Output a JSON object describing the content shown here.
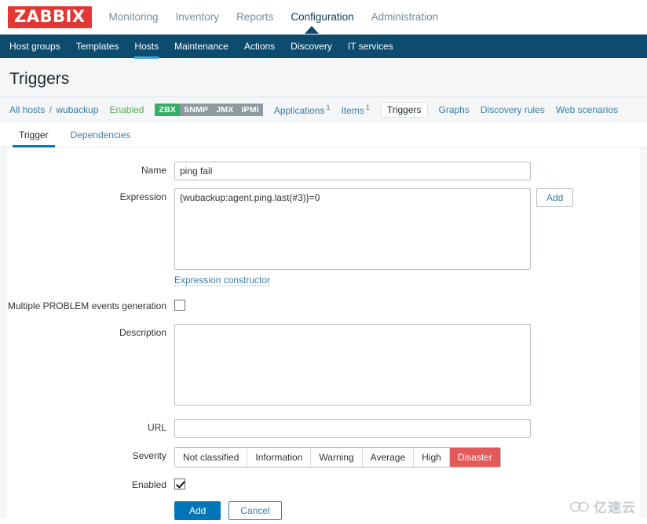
{
  "brand": {
    "logo_text": "ZABBIX",
    "logo_color": "#e33734"
  },
  "mainnav": {
    "items": [
      {
        "label": "Monitoring",
        "active": false
      },
      {
        "label": "Inventory",
        "active": false
      },
      {
        "label": "Reports",
        "active": false
      },
      {
        "label": "Configuration",
        "active": true
      },
      {
        "label": "Administration",
        "active": false
      }
    ]
  },
  "subnav": {
    "items": [
      {
        "label": "Host groups",
        "active": false
      },
      {
        "label": "Templates",
        "active": false
      },
      {
        "label": "Hosts",
        "active": true
      },
      {
        "label": "Maintenance",
        "active": false
      },
      {
        "label": "Actions",
        "active": false
      },
      {
        "label": "Discovery",
        "active": false
      },
      {
        "label": "IT services",
        "active": false
      }
    ]
  },
  "page": {
    "title": "Triggers"
  },
  "breadcrumb": {
    "all_hosts": "All hosts",
    "separator": "/",
    "host": "wubackup",
    "status": "Enabled",
    "status_color": "#5aab5a",
    "badges": [
      {
        "label": "ZBX",
        "state": "on",
        "color": "#34af67"
      },
      {
        "label": "SNMP",
        "state": "off",
        "color": "#8e9a9f"
      },
      {
        "label": "JMX",
        "state": "off",
        "color": "#8e9a9f"
      },
      {
        "label": "IPMI",
        "state": "off",
        "color": "#8e9a9f"
      }
    ],
    "links": [
      {
        "label": "Applications",
        "count": "1",
        "selected": false
      },
      {
        "label": "Items",
        "count": "1",
        "selected": false
      },
      {
        "label": "Triggers",
        "count": "",
        "selected": true
      },
      {
        "label": "Graphs",
        "count": "",
        "selected": false
      },
      {
        "label": "Discovery rules",
        "count": "",
        "selected": false
      },
      {
        "label": "Web scenarios",
        "count": "",
        "selected": false
      }
    ]
  },
  "form_tabs": [
    {
      "label": "Trigger",
      "active": true
    },
    {
      "label": "Dependencies",
      "active": false
    }
  ],
  "form": {
    "name_label": "Name",
    "name_value": "ping fail",
    "name_placeholder": "",
    "expression_label": "Expression",
    "expression_value": "{wubackup:agent.ping.last(#3)}=0",
    "expression_add_button": "Add",
    "expression_constructor_link": "Expression constructor",
    "multiple_problem_label": "Multiple PROBLEM events generation",
    "multiple_problem_checked": false,
    "description_label": "Description",
    "description_value": "",
    "url_label": "URL",
    "url_value": "",
    "url_placeholder": "",
    "severity_label": "Severity",
    "severity_options": [
      {
        "label": "Not classified",
        "selected": false
      },
      {
        "label": "Information",
        "selected": false
      },
      {
        "label": "Warning",
        "selected": false
      },
      {
        "label": "Average",
        "selected": false
      },
      {
        "label": "High",
        "selected": false
      },
      {
        "label": "Disaster",
        "selected": true
      }
    ],
    "severity_selected_color": "#e45959",
    "enabled_label": "Enabled",
    "enabled_checked": true,
    "submit_label": "Add",
    "cancel_label": "Cancel"
  },
  "watermark": {
    "text": "亿速云",
    "icon": "cloud-icon"
  }
}
